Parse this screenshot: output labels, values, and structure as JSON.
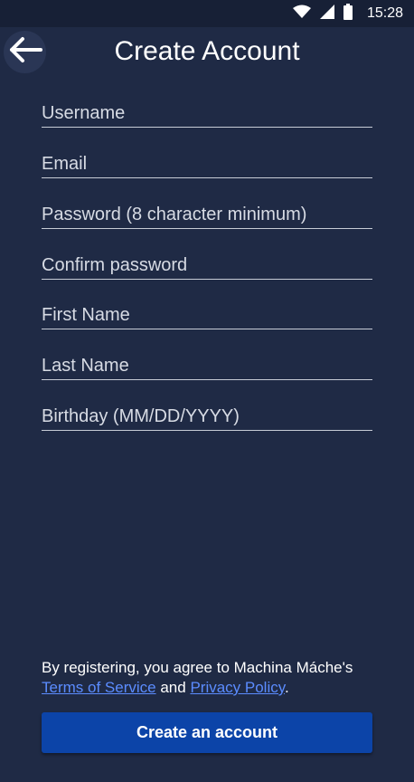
{
  "status_bar": {
    "time": "15:28",
    "icons": [
      "wifi-icon",
      "signal-icon",
      "battery-icon"
    ]
  },
  "header": {
    "title": "Create Account",
    "back_icon": "arrow-left-icon"
  },
  "form": {
    "fields": [
      {
        "name": "username",
        "placeholder": "Username",
        "value": ""
      },
      {
        "name": "email",
        "placeholder": "Email",
        "value": ""
      },
      {
        "name": "password",
        "placeholder": "Password (8 character minimum)",
        "value": ""
      },
      {
        "name": "confirm_password",
        "placeholder": "Confirm password",
        "value": ""
      },
      {
        "name": "first_name",
        "placeholder": "First Name",
        "value": ""
      },
      {
        "name": "last_name",
        "placeholder": "Last Name",
        "value": ""
      },
      {
        "name": "birthday",
        "placeholder": "Birthday (MM/DD/YYYY)",
        "value": ""
      }
    ]
  },
  "terms": {
    "prefix": "By registering, you agree to Machina Máche's",
    "terms_link": "Terms of Service",
    "conjunction": "and",
    "privacy_link": "Privacy Policy",
    "suffix": "."
  },
  "actions": {
    "create_label": "Create an account"
  },
  "colors": {
    "background": "#1f2a45",
    "status_bar": "#172036",
    "button": "#0c44a8",
    "link": "#5b8cff"
  }
}
